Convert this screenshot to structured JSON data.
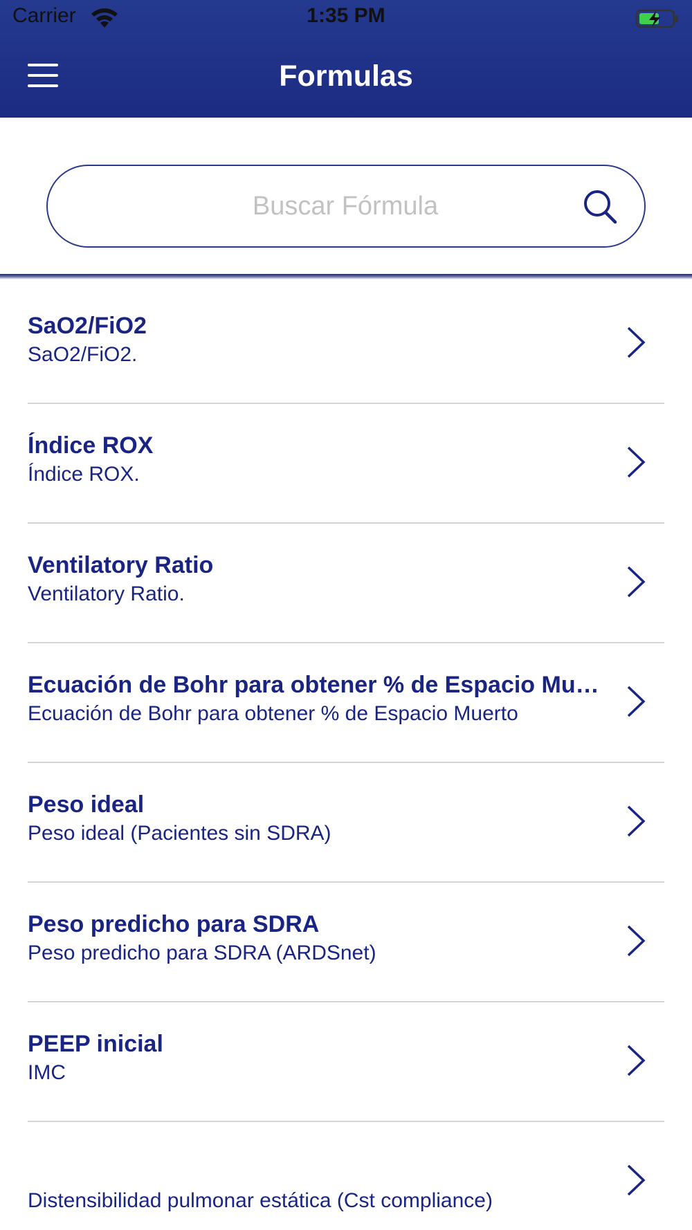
{
  "status_bar": {
    "carrier": "Carrier",
    "time": "1:35 PM",
    "wifi_icon": "wifi-icon",
    "battery_icon": "battery-charging-icon"
  },
  "nav": {
    "title": "Formulas",
    "menu_icon": "hamburger-menu-icon"
  },
  "search": {
    "placeholder": "Buscar Fórmula",
    "value": "",
    "icon": "search-icon"
  },
  "colors": {
    "header": "#1c2b82",
    "accent": "#1a2583",
    "separator": "#d4d4d4"
  },
  "formulas": [
    {
      "title": "SaO2/FiO2",
      "subtitle": "SaO2/FiO2."
    },
    {
      "title": "Índice ROX",
      "subtitle": "Índice ROX."
    },
    {
      "title": "Ventilatory Ratio",
      "subtitle": "Ventilatory Ratio."
    },
    {
      "title": "Ecuación de Bohr para obtener % de Espacio Muerto",
      "subtitle": "Ecuación de Bohr para obtener % de Espacio Muerto"
    },
    {
      "title": "Peso ideal",
      "subtitle": "Peso ideal (Pacientes sin SDRA)"
    },
    {
      "title": "Peso predicho para SDRA",
      "subtitle": "Peso predicho para SDRA (ARDSnet)"
    },
    {
      "title": "PEEP inicial",
      "subtitle": "IMC"
    },
    {
      "title": "",
      "subtitle": "Distensibilidad pulmonar estática (Cst compliance)"
    }
  ]
}
